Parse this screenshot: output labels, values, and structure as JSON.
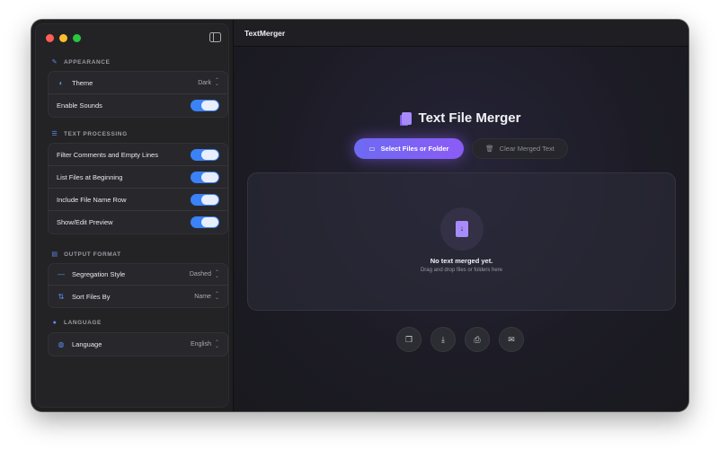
{
  "window": {
    "title": "TextMerger"
  },
  "sidebar": {
    "appearance": {
      "header": "APPEARANCE",
      "theme_label": "Theme",
      "theme_value": "Dark",
      "sounds_label": "Enable Sounds",
      "sounds_on": true
    },
    "text_processing": {
      "header": "TEXT PROCESSING",
      "items": [
        {
          "label": "Filter Comments and Empty Lines",
          "on": true
        },
        {
          "label": "List Files at Beginning",
          "on": true
        },
        {
          "label": "Include File Name Row",
          "on": true
        },
        {
          "label": "Show/Edit Preview",
          "on": true
        }
      ]
    },
    "output_format": {
      "header": "OUTPUT FORMAT",
      "segregation_label": "Segregation Style",
      "segregation_value": "Dashed",
      "sort_label": "Sort Files By",
      "sort_value": "Name"
    },
    "language": {
      "header": "LANGUAGE",
      "label": "Language",
      "value": "English"
    }
  },
  "main": {
    "heading": "Text File Merger",
    "select_button": "Select Files or Folder",
    "clear_button": "Clear Merged Text",
    "dropzone": {
      "title": "No text merged yet.",
      "subtitle": "Drag and drop files or folders here"
    },
    "actions": [
      "copy-icon",
      "save-icon",
      "print-icon",
      "email-icon"
    ]
  },
  "colors": {
    "accent": "#3b82f6",
    "primary_gradient_start": "#6d6af3",
    "primary_gradient_end": "#8b5cf6",
    "icon_purple": "#a78bfa"
  }
}
